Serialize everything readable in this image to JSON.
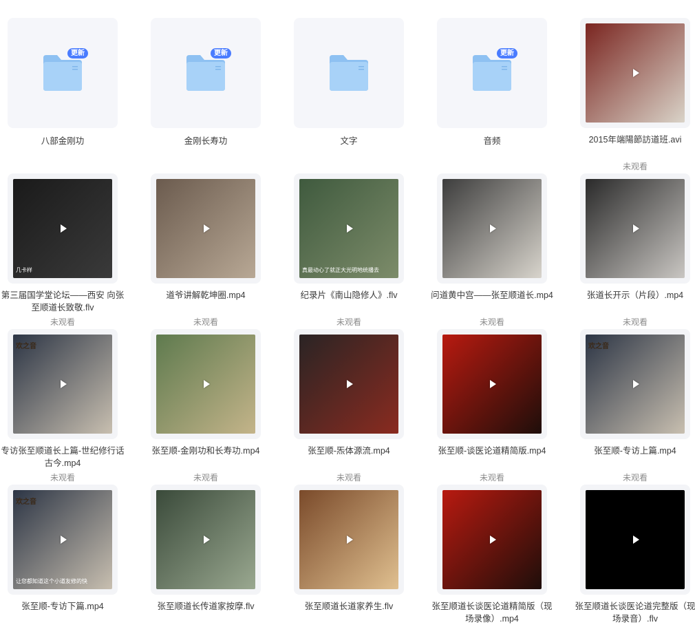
{
  "items": [
    {
      "kind": "folder",
      "name": "八部金刚功",
      "badge": "更新"
    },
    {
      "kind": "folder",
      "name": "金刚长寿功",
      "badge": "更新"
    },
    {
      "kind": "folder",
      "name": "文字",
      "badge": ""
    },
    {
      "kind": "folder",
      "name": "音频",
      "badge": "更新"
    },
    {
      "kind": "video",
      "name": "2015年端陽節訪道班.avi",
      "status": "未观看",
      "colors": [
        "#7a2520",
        "#d9d3c8"
      ]
    },
    {
      "kind": "video",
      "name": "第三届国学堂论坛——西安 向张至顺道长致敬.flv",
      "status": "未观看",
      "colors": [
        "#1a1a1a",
        "#3a3a3a"
      ],
      "caption": "几卡样"
    },
    {
      "kind": "video",
      "name": "道爷讲解乾坤圈.mp4",
      "status": "未观看",
      "colors": [
        "#6b5b4e",
        "#b8a895"
      ]
    },
    {
      "kind": "video",
      "name": "纪录片《南山隐修人》.flv",
      "status": "未观看",
      "colors": [
        "#3f5a3e",
        "#7d8c6a"
      ],
      "caption": "真最动心了就正大光明地统播去"
    },
    {
      "kind": "video",
      "name": "问道黄中宫——张至顺道长.mp4",
      "status": "未观看",
      "colors": [
        "#3d3d3d",
        "#d8d4cc"
      ]
    },
    {
      "kind": "video",
      "name": "张道长开示（片段）.mp4",
      "status": "未观看",
      "colors": [
        "#2a2a2a",
        "#c9c6c2"
      ]
    },
    {
      "kind": "video",
      "name": "专访张至顺道长上篇-世纪修行话古今.mp4",
      "status": "未观看",
      "colors": [
        "#2c3545",
        "#c8bfb0"
      ],
      "tag": "欢之音"
    },
    {
      "kind": "video",
      "name": "张至顺-金刚功和长寿功.mp4",
      "status": "未观看",
      "colors": [
        "#5e7a4e",
        "#c4b48a"
      ]
    },
    {
      "kind": "video",
      "name": "张至顺-炁体源流.mp4",
      "status": "未观看",
      "colors": [
        "#2a2424",
        "#8a2b20"
      ]
    },
    {
      "kind": "video",
      "name": "张至顺-谈医论道精简版.mp4",
      "status": "未观看",
      "colors": [
        "#b81a10",
        "#1e0e0a"
      ]
    },
    {
      "kind": "video",
      "name": "张至顺-专访上篇.mp4",
      "status": "未观看",
      "colors": [
        "#2c3545",
        "#c8bfb0"
      ],
      "tag": "欢之音"
    },
    {
      "kind": "video",
      "name": "张至顺-专访下篇.mp4",
      "status": "",
      "colors": [
        "#2c3545",
        "#c8bfb0"
      ],
      "tag": "欢之音",
      "caption": "让您都知道这个小道友修的快"
    },
    {
      "kind": "video",
      "name": "张至顺道长传道家按摩.flv",
      "status": "",
      "colors": [
        "#3a4a3a",
        "#9aa890"
      ]
    },
    {
      "kind": "video",
      "name": "张至顺道长道家养生.flv",
      "status": "",
      "colors": [
        "#7a4a2a",
        "#e0c090"
      ]
    },
    {
      "kind": "video",
      "name": "张至顺道长谈医论道精简版（现场录像）.mp4",
      "status": "",
      "colors": [
        "#b81a10",
        "#1e0e0a"
      ]
    },
    {
      "kind": "video",
      "name": "张至顺道长谈医论道完整版（现场录音）.flv",
      "status": "",
      "colors": [
        "#000000",
        "#000000"
      ]
    }
  ]
}
